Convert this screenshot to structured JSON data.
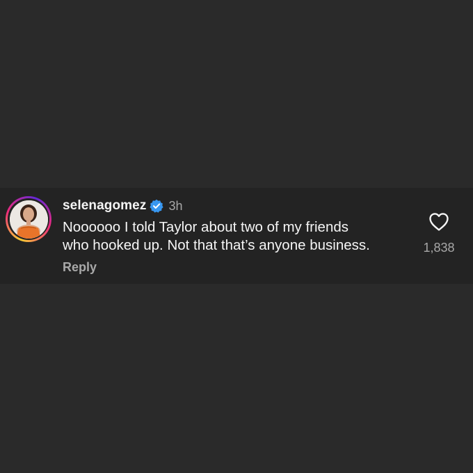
{
  "comment": {
    "username": "selenagomez",
    "verified_icon": "verified-badge-icon",
    "time": "3h",
    "text_line1": "Noooooo I told Taylor about two of my friends",
    "text_line2": "who hooked up. Not that that’s anyone business.",
    "reply_label": "Reply",
    "like_icon": "heart-outline-icon",
    "likes": "1,838"
  },
  "colors": {
    "page_background": "#2a2a2a",
    "card_background": "#232323",
    "primary_text": "#f5f5f5",
    "secondary_text": "#a8a8a8",
    "verified_blue": "#3897f0"
  }
}
